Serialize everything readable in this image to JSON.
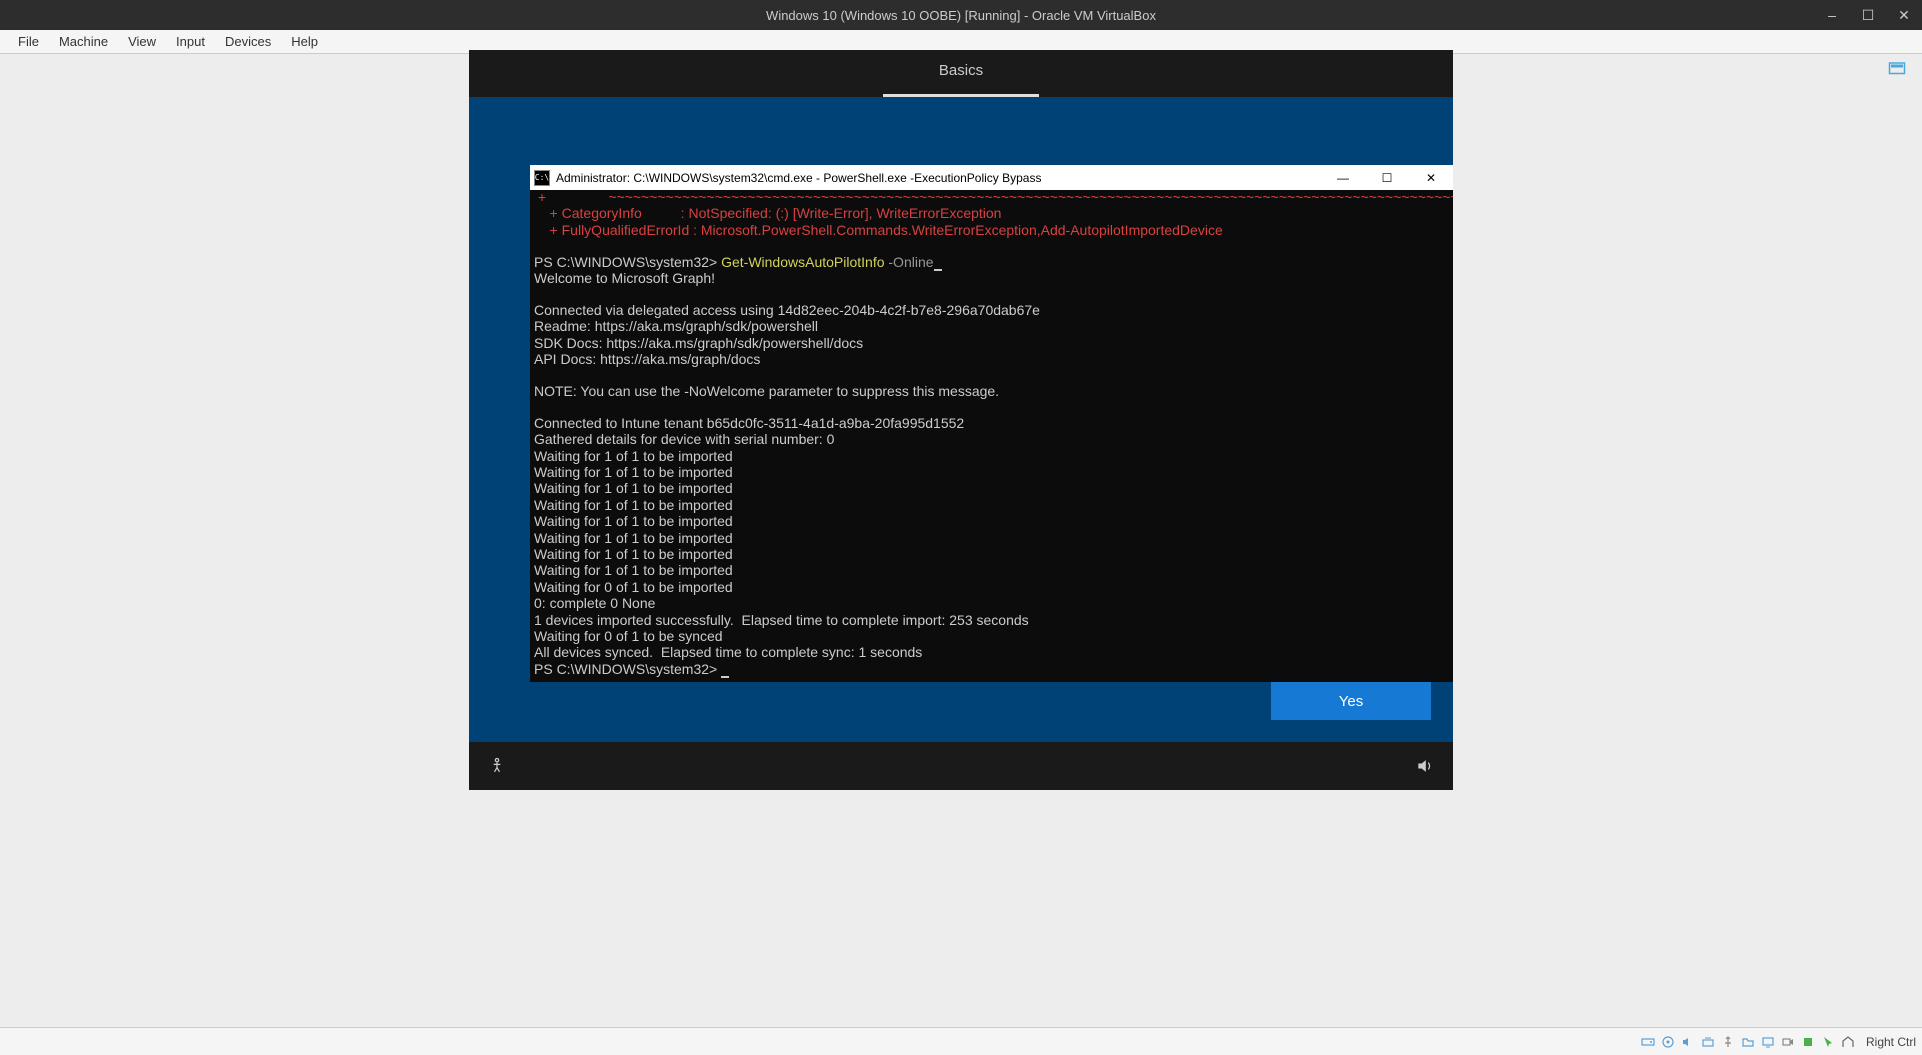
{
  "vbox": {
    "title": "Windows 10 (Windows 10 OOBE) [Running] - Oracle VM VirtualBox",
    "menu": [
      "File",
      "Machine",
      "View",
      "Input",
      "Devices",
      "Help"
    ]
  },
  "oobe": {
    "tab": "Basics",
    "yes": "Yes"
  },
  "cmd": {
    "title": "Administrator: C:\\WINDOWS\\system32\\cmd.exe - PowerShell.exe  -ExecutionPolicy Bypass",
    "icon_text": "C:\\",
    "err_top_prefix": " +                ",
    "err_top_tildes": "~~~~~~~~~~~~~~~~~~~~~~~~~~~~~~~~~~~~~~~~~~~~~~~~~~~~~~~~~~~~~~~~~~~~~~~~~~~~~~~~~~~~~~~~~~~~~~~~~~~~~~~~~~~",
    "err_cat": "    + CategoryInfo          : NotSpecified: (:) [Write-Error], WriteErrorException",
    "err_fq": "    + FullyQualifiedErrorId : Microsoft.PowerShell.Commands.WriteErrorException,Add-AutopilotImportedDevice",
    "prompt1": "PS C:\\WINDOWS\\system32> ",
    "cmd_name": "Get-WindowsAutoPilotInfo",
    "cmd_arg": " -Online",
    "welcome": "Welcome to Microsoft Graph!",
    "conn": "Connected via delegated access using 14d82eec-204b-4c2f-b7e8-296a70dab67e",
    "readme": "Readme: https://aka.ms/graph/sdk/powershell",
    "sdk": "SDK Docs: https://aka.ms/graph/sdk/powershell/docs",
    "api": "API Docs: https://aka.ms/graph/docs",
    "note": "NOTE: You can use the -NoWelcome parameter to suppress this message.",
    "tenant": "Connected to Intune tenant b65dc0fc-3511-4a1d-a9ba-20fa995d1552",
    "gather": "Gathered details for device with serial number: 0",
    "wait1": "Waiting for 1 of 1 to be imported",
    "wait0": "Waiting for 0 of 1 to be imported",
    "zero_complete": "0: complete 0 None",
    "imported": "1 devices imported successfully.  Elapsed time to complete import: 253 seconds",
    "sync_wait": "Waiting for 0 of 1 to be synced",
    "sync_done": "All devices synced.  Elapsed time to complete sync: 1 seconds",
    "prompt2": "PS C:\\WINDOWS\\system32> "
  },
  "status": {
    "host_key": "Right Ctrl"
  }
}
